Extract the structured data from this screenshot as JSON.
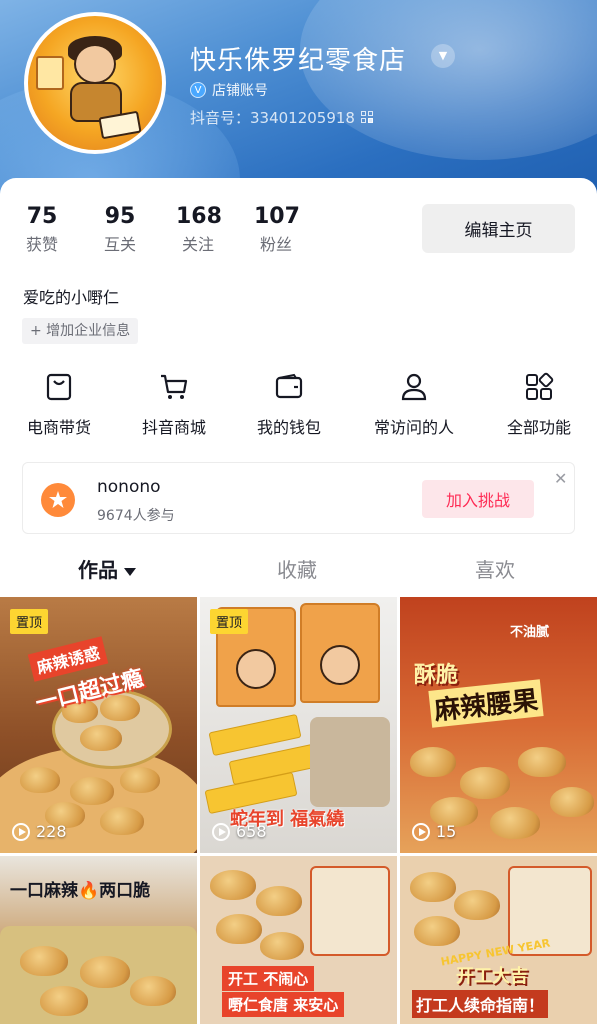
{
  "profile": {
    "store_name": "快乐侏罗纪零食店",
    "account_badge": "店铺账号",
    "douyin_id": "抖音号：33401205918",
    "bio": "爱吃的小嘢仁",
    "add_enterprise_info": "+ 增加企业信息"
  },
  "stats": [
    {
      "value": "75",
      "label": "获赞"
    },
    {
      "value": "95",
      "label": "互关"
    },
    {
      "value": "168",
      "label": "关注"
    },
    {
      "value": "107",
      "label": "粉丝"
    }
  ],
  "edit_button": "编辑主页",
  "shortcuts": [
    {
      "label": "电商带货",
      "icon": "shopping-bag-icon"
    },
    {
      "label": "抖音商城",
      "icon": "cart-icon"
    },
    {
      "label": "我的钱包",
      "icon": "wallet-icon"
    },
    {
      "label": "常访问的人",
      "icon": "person-icon"
    },
    {
      "label": "全部功能",
      "icon": "grid-icon"
    }
  ],
  "challenge": {
    "title": "nonono",
    "participants": "9674人参与",
    "join_button": "加入挑战"
  },
  "tabs": [
    {
      "label": "作品",
      "active": true
    },
    {
      "label": "收藏",
      "active": false
    },
    {
      "label": "喜欢",
      "active": false
    }
  ],
  "videos": [
    {
      "pinned": "置顶",
      "plays": "228",
      "caption_1": "麻辣诱惑",
      "caption_2": "一口超过瘾"
    },
    {
      "pinned": "置顶",
      "plays": "658",
      "caption_1": "蛇年到 福氣繞"
    },
    {
      "plays": "15",
      "caption_1": "酥脆",
      "caption_2": "麻辣腰果",
      "caption_3": "不油腻"
    },
    {
      "caption_1": "一口麻辣🔥两口脆"
    },
    {
      "caption_1": "开工 不闹心",
      "caption_2": "嘢仁食唐 来安心"
    },
    {
      "caption_1": "开工大吉",
      "caption_2": "打工人续命指南！",
      "caption_3": "HAPPY NEW YEAR"
    }
  ],
  "colors": {
    "accent_red": "#fe2c55",
    "header_blue": "#2b6fc0",
    "pin_yellow": "#fdd531"
  }
}
